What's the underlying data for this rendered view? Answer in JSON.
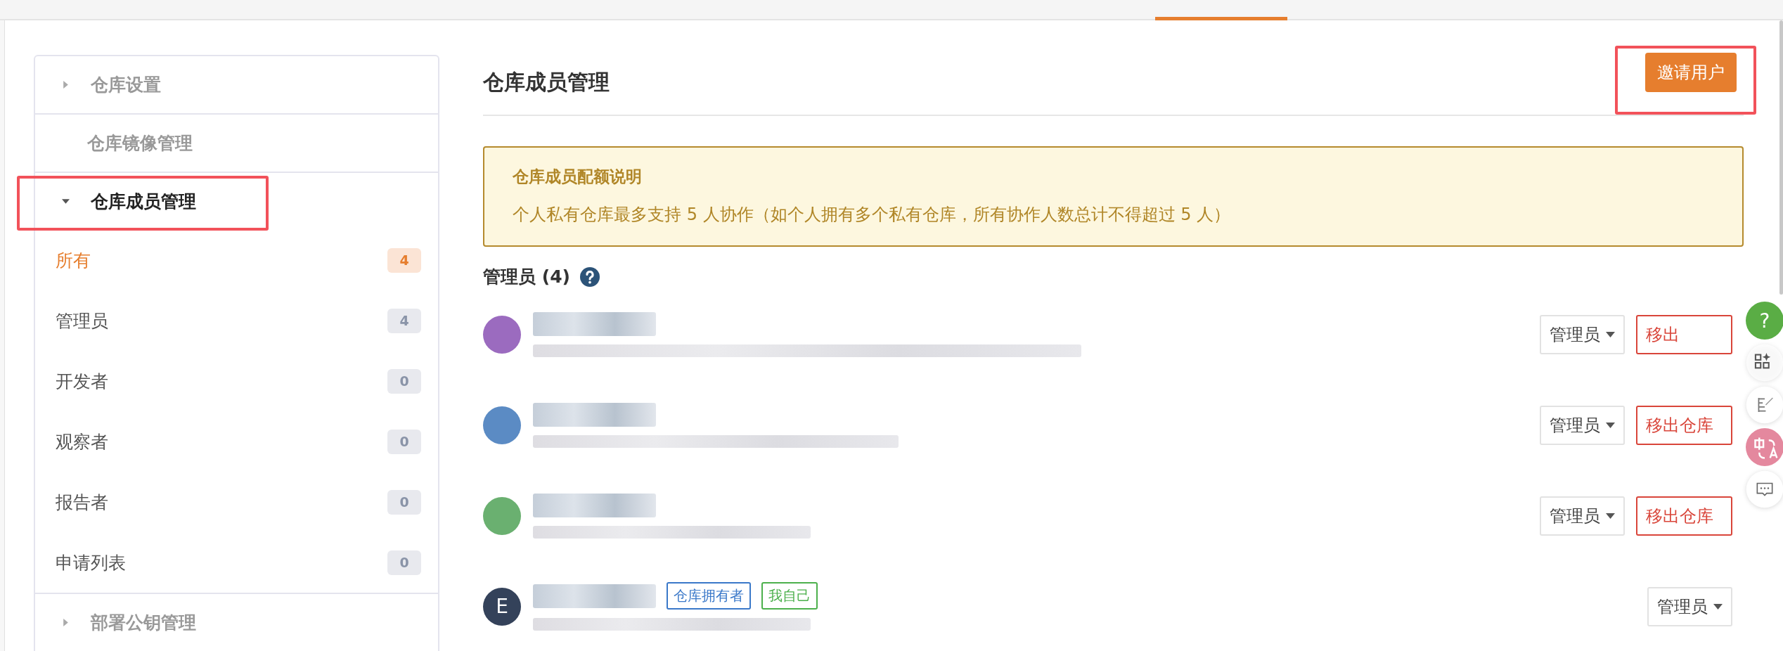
{
  "sidebar": {
    "sections": [
      {
        "label": "仓库设置",
        "has_arrow": true,
        "expanded": false
      },
      {
        "label": "仓库镜像管理",
        "has_arrow": false,
        "expanded": false
      },
      {
        "label": "仓库成员管理",
        "has_arrow": true,
        "expanded": true,
        "highlighted": true,
        "items": [
          {
            "label": "所有",
            "count": "4",
            "selected": true
          },
          {
            "label": "管理员",
            "count": "4",
            "selected": false
          },
          {
            "label": "开发者",
            "count": "0",
            "selected": false
          },
          {
            "label": "观察者",
            "count": "0",
            "selected": false
          },
          {
            "label": "报告者",
            "count": "0",
            "selected": false
          },
          {
            "label": "申请列表",
            "count": "0",
            "selected": false
          }
        ]
      },
      {
        "label": "部署公钥管理",
        "has_arrow": true,
        "expanded": false
      }
    ]
  },
  "main": {
    "title": "仓库成员管理",
    "invite_button": {
      "label": "邀请用户",
      "highlighted": true
    },
    "notice": {
      "title": "仓库成员配额说明",
      "text": "个人私有仓库最多支持 5 人协作（如个人拥有多个私有仓库，所有协作人数总计不得超过 5 人）"
    },
    "group_heading": "管理员 (4)",
    "members": [
      {
        "color": "#9b6bbf",
        "role": "管理员",
        "remove": "移出"
      },
      {
        "color": "#5b8bc4",
        "role": "管理员",
        "remove": "移出仓库"
      },
      {
        "color": "#6ab070",
        "role": "管理员",
        "remove": "移出仓库"
      },
      {
        "color": "#34425a",
        "avatar_letter": "E",
        "role": "管理员",
        "tags": [
          {
            "label": "仓库拥有者",
            "color": "#3a78c9"
          },
          {
            "label": "我自己",
            "color": "#4cb04c"
          }
        ]
      }
    ]
  },
  "help_fab": "?"
}
